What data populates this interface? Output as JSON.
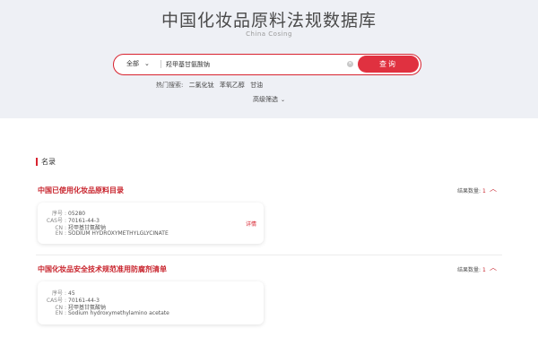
{
  "header": {
    "title": "中国化妆品原料法规数据库",
    "subtitle": "China Cosing"
  },
  "search": {
    "scope": "全部",
    "query": "羟甲基甘氨酸钠",
    "button": "查询"
  },
  "hot": {
    "label": "热门搜索:",
    "items": [
      "二氯化钛",
      "苯氧乙醇",
      "甘油"
    ]
  },
  "advanced_label": "高级筛选",
  "section": {
    "title": "名录"
  },
  "categories": [
    {
      "title": "中国已使用化妆品原料目录",
      "count_label": "结果数量:",
      "count": "1",
      "record": {
        "seq_key": "序号",
        "seq": "05280",
        "cas_key": "CAS号",
        "cas": "70161-44-3",
        "cn_key": "CN",
        "cn": "羟甲基甘氨酸钠",
        "en_key": "EN",
        "en": "SODIUM HYDROXYMETHYLGLYCINATE",
        "detail": "详情"
      }
    },
    {
      "title": "中国化妆品安全技术规范准用防腐剂清单",
      "count_label": "结果数量:",
      "count": "1",
      "record": {
        "seq_key": "序号",
        "seq": "45",
        "cas_key": "CAS号",
        "cas": "70161-44-3",
        "cn_key": "CN",
        "cn": "羟甲基甘氨酸钠",
        "en_key": "EN",
        "en": "Sodium hydroxymethylamino acetate"
      }
    }
  ],
  "colors": {
    "accent": "#d8232f",
    "hero_bg": "#eef0f5"
  }
}
